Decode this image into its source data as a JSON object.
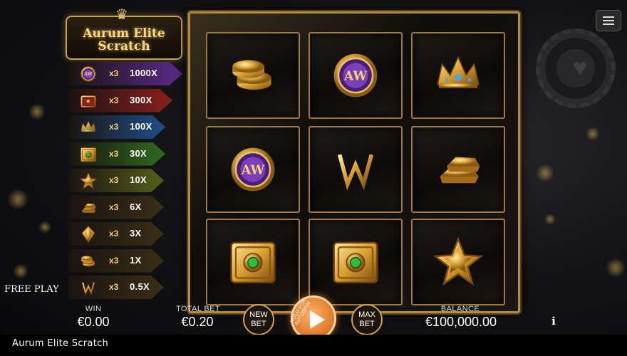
{
  "logo": {
    "line1": "Aurum Elite",
    "line2": "Scratch"
  },
  "paytable": [
    {
      "icon": "purple-medallion-icon",
      "count": "x3",
      "payout": "1000X",
      "color": "#5b2a8a"
    },
    {
      "icon": "red-treasure-box-icon",
      "count": "x3",
      "payout": "300X",
      "color": "#8a1f1f"
    },
    {
      "icon": "crown-icon",
      "count": "x3",
      "payout": "100X",
      "color": "#1f4f8a"
    },
    {
      "icon": "gold-vault-icon",
      "count": "x3",
      "payout": "30X",
      "color": "#2f6a1f"
    },
    {
      "icon": "star-icon",
      "count": "x3",
      "payout": "10X",
      "color": "#55601a"
    },
    {
      "icon": "gold-bars-icon",
      "count": "x3",
      "payout": "6X",
      "color": "#3a2e16"
    },
    {
      "icon": "gold-diamond-icon",
      "count": "x3",
      "payout": "3X",
      "color": "#3a2e16"
    },
    {
      "icon": "gold-coins-icon",
      "count": "x3",
      "payout": "1X",
      "color": "#3a2e16"
    },
    {
      "icon": "aw-emblem-icon",
      "count": "x3",
      "payout": "0.5X",
      "color": "#3a2e16"
    }
  ],
  "grid": [
    "gold-coins-icon",
    "purple-medallion-icon",
    "crown-icon",
    "purple-medallion-icon",
    "aw-emblem-icon",
    "gold-bars-icon",
    "gold-vault-icon",
    "gold-vault-icon",
    "star-icon"
  ],
  "status": {
    "free_play": "FREE PLAY"
  },
  "bottom": {
    "win_label": "WIN",
    "win_value": "€0.00",
    "total_bet_label": "TOTAL BET",
    "total_bet_value": "€0.20",
    "new_bet_line1": "NEW",
    "new_bet_line2": "BET",
    "spin_hint": "HOLD FOR AUTOSPIN",
    "max_bet_line1": "MAX",
    "max_bet_line2": "BET",
    "balance_label": "BALANCE",
    "balance_value": "€100,000.00",
    "info_label": "i"
  },
  "footer": {
    "title": "Aurum Elite Scratch"
  }
}
